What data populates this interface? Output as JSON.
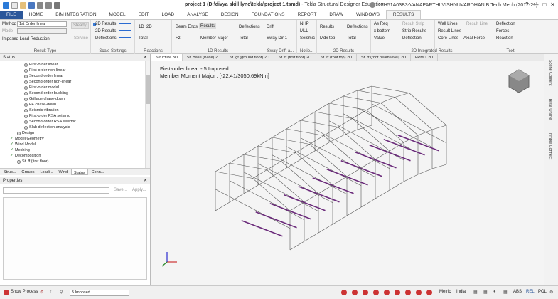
{
  "window": {
    "title_main": "project 1 (D:\\divya skill lync\\tekla\\project 1.tsmd)",
    "title_app": " - Tekla Structural Designer Education",
    "user": "17H51A03B3-VANAPARTHI VISHNUVARDHAN B.Tech Mech (2017-21)",
    "help": "?"
  },
  "tabs": [
    "FILE",
    "HOME",
    "BIM INTEGRATION",
    "MODEL",
    "EDIT",
    "LOAD",
    "ANALYSE",
    "DESIGN",
    "FOUNDATIONS",
    "REPORT",
    "DRAW",
    "WINDOWS",
    "RESULTS"
  ],
  "ribbon": {
    "method_label": "Method",
    "method_value": "1st Order linear",
    "mode_label": "Mode",
    "imposed_load": "Imposed Load Reduction",
    "steady": "Steady",
    "service": "Service",
    "result_type": "Result Type",
    "scale": [
      "2D Results",
      "2D Results",
      "Deflections"
    ],
    "scale_settings": "Scale Settings",
    "reactions_items": [
      "1D",
      "2D",
      "Total"
    ],
    "reactions_label": "Reactions",
    "beam_ends": "Beam Ends",
    "results": "Results",
    "fz": "Fz",
    "member_major": "Member Major",
    "deflections": "Deflections",
    "total": "Total",
    "results_1d": "1D Results",
    "drift": "Drift",
    "sway_dir": "Sway Dir 1",
    "sway_drift": "Sway Drift a...",
    "notional": "Notio...",
    "nhp": "NHP",
    "mll": "MLL",
    "seismic": "Seismic",
    "results2": "Results",
    "mdx_top": "Mdx top",
    "deflections2": "Deflections",
    "total2": "Total",
    "results_2d": "2D Results",
    "as_req": "As Req",
    "x_bottom": "x bottom",
    "value": "Value",
    "result_strip": "Result Strip",
    "strip_results": "Strip Results",
    "deflection": "Deflection",
    "wall_lines": "Wall Lines",
    "result_lines": "Result Lines",
    "core_lines": "Core Lines",
    "result_line": "Result Line",
    "axial_force": "Axial Force",
    "integrated": "2D Integrated Results",
    "text_items": [
      "Deflection",
      "Forces",
      "Reaction"
    ],
    "text_label": "Text"
  },
  "status_panel": {
    "title": "Status",
    "nodes": [
      {
        "label": "First-order linear",
        "level": 3
      },
      {
        "label": "First-order non-linear",
        "level": 3
      },
      {
        "label": "Second-order linear",
        "level": 3
      },
      {
        "label": "Second-order non-linear",
        "level": 3
      },
      {
        "label": "First-order modal",
        "level": 3
      },
      {
        "label": "Second-order buckling",
        "level": 3
      },
      {
        "label": "Grillage chase-down",
        "level": 3
      },
      {
        "label": "FE chase-down",
        "level": 3
      },
      {
        "label": "Seismic vibration",
        "level": 3
      },
      {
        "label": "First-order RSA seismic",
        "level": 3
      },
      {
        "label": "Second-order RSA seismic",
        "level": 3
      },
      {
        "label": "Slab deflection analysis",
        "level": 3
      },
      {
        "label": "Design",
        "level": 2
      },
      {
        "label": "Model Geometry",
        "level": 1
      },
      {
        "label": "Wind Model",
        "level": 1
      },
      {
        "label": "Meshing",
        "level": 1
      },
      {
        "label": "Decomposition",
        "level": 1
      },
      {
        "label": "St. ff (first floor)",
        "level": 2
      }
    ]
  },
  "panel_tabs": [
    "Struc...",
    "Groups",
    "Loadi...",
    "Wind",
    "Status",
    "Conn..."
  ],
  "properties": {
    "title": "Properties",
    "save": "Save...",
    "apply": "Apply..."
  },
  "view_tabs": [
    "Structure 3D",
    "St. Base (Base) 2D",
    "St. gf (ground floor) 2D",
    "St. ff (first floor) 2D",
    "St. rt (roof top) 2D",
    "St. rf (roof beam level) 2D",
    "FRM 1 2D"
  ],
  "view": {
    "line1": "First-order linear - 5 Imposed",
    "line2": "Member Moment Major  : [-22.41/3050.69kNm]"
  },
  "right_rail": [
    "Scene Content",
    "Tekla Online",
    "Trimble Connect"
  ],
  "statusbar": {
    "show_process": "Show Process",
    "combo": "5 Imposed",
    "metric": "Metric",
    "country": "India",
    "abs": "ABS",
    "rel": "REL",
    "pol": "POL"
  },
  "colors": {
    "file_tab": "#2b579a",
    "moment": "#6a2a7a"
  }
}
